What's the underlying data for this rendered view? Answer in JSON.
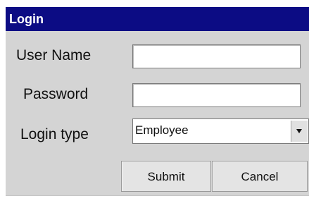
{
  "window": {
    "title": "Login"
  },
  "form": {
    "username": {
      "label": "User Name",
      "value": ""
    },
    "password": {
      "label": "Password",
      "value": ""
    },
    "login_type": {
      "label": "Login type",
      "selected": "Employee"
    }
  },
  "buttons": {
    "submit_label": "Submit",
    "cancel_label": "Cancel"
  },
  "colors": {
    "title_bar": "#0c0c84",
    "dialog_background": "#d4d4d4"
  },
  "icons": {
    "dropdown": "chevron-down-icon"
  }
}
